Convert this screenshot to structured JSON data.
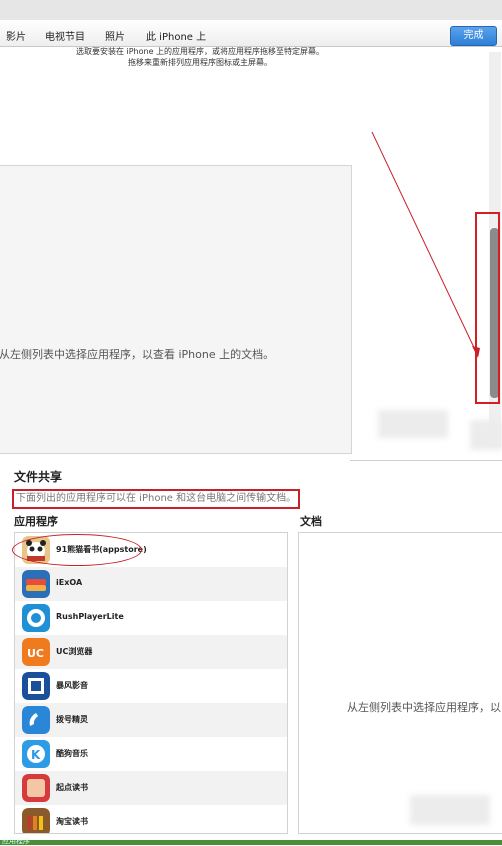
{
  "nav": {
    "tabs": [
      "影片",
      "电视节目",
      "照片",
      "此 iPhone 上"
    ],
    "done_label": "完成"
  },
  "instructions": {
    "line1": "选取要安装在 iPhone 上的应用程序，或将应用程序拖移至特定屏幕。",
    "line2": "拖移来重新排列应用程序图标或主屏幕。"
  },
  "preview": {
    "message": "从左侧列表中选择应用程序，以查看 iPhone 上的文档。"
  },
  "file_sharing": {
    "title": "文件共享",
    "description": "下面列出的应用程序可以在 iPhone 和这台电脑之间传输文档。",
    "apps_header": "应用程序",
    "docs_header": "文档",
    "docs_message": "从左侧列表中选择应用程序，以",
    "apps": [
      {
        "name": "91熊猫看书(appstore)",
        "icon": "panda-reader-icon"
      },
      {
        "name": "iExOA",
        "icon": "iexoa-icon"
      },
      {
        "name": "RushPlayerLite",
        "icon": "rushplayer-icon"
      },
      {
        "name": "UC浏览器",
        "icon": "uc-browser-icon"
      },
      {
        "name": "暴风影音",
        "icon": "baofeng-icon"
      },
      {
        "name": "拨号精灵",
        "icon": "dialer-icon"
      },
      {
        "name": "酷狗音乐",
        "icon": "kugou-icon"
      },
      {
        "name": "起点读书",
        "icon": "qidian-icon"
      },
      {
        "name": "淘宝读书",
        "icon": "taobao-reader-icon"
      }
    ]
  },
  "status": {
    "text": "应用程序"
  },
  "colors": {
    "accent_blue": "#2d7ed6",
    "highlight_red": "#c8202a",
    "status_green": "#4a8e3a"
  }
}
